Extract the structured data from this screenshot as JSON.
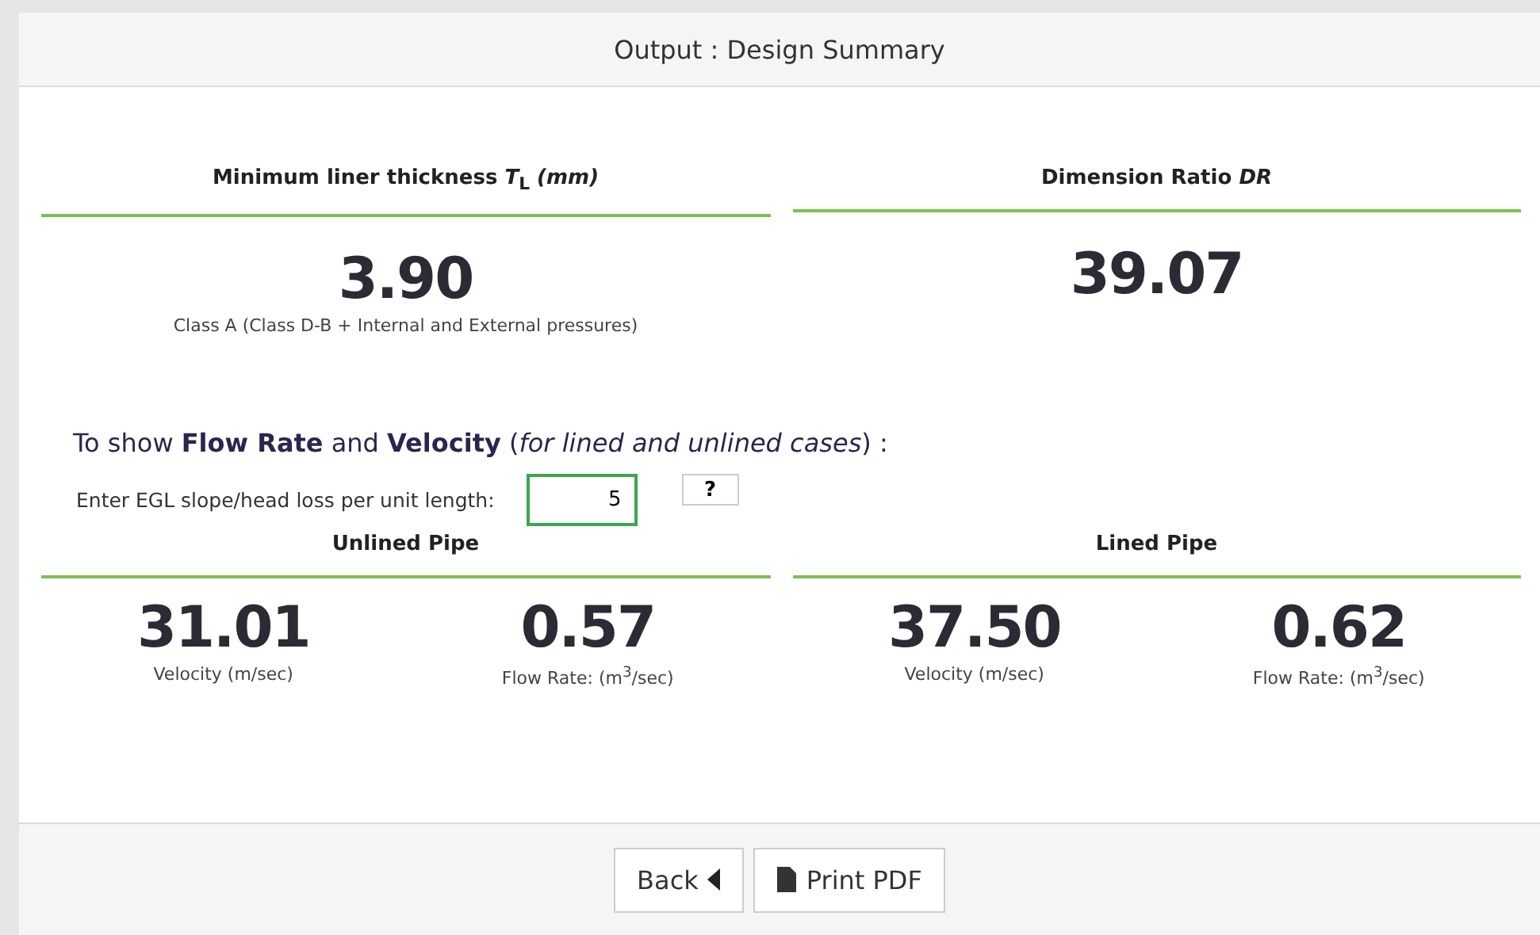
{
  "header": {
    "title": "Output : Design Summary"
  },
  "summary": [
    {
      "title": "Minimum liner thickness *T*$_{L}$ *(mm)*",
      "value": "3.90",
      "note": "Class A (Class D-B + Internal and External pressures)"
    },
    {
      "title": "Dimension Ratio *DR*",
      "value": "39.07"
    }
  ],
  "flow": {
    "intro": "To show **Flow Rate** and **Velocity** (*for lined and unlined cases*) :",
    "input_label": "Enter EGL slope/head loss per unit length:",
    "input_value": "5",
    "help": "?"
  },
  "pipes": [
    {
      "title": "Unlined Pipe",
      "metrics": [
        {
          "value": "31.01",
          "label": "Velocity (m/sec)"
        },
        {
          "value": "0.57",
          "label": "Flow Rate: (m$^{3}$/sec)"
        }
      ]
    },
    {
      "title": "Lined Pipe",
      "metrics": [
        {
          "value": "37.50",
          "label": "Velocity (m/sec)"
        },
        {
          "value": "0.62",
          "label": "Flow Rate: (m$^{3}$/sec)"
        }
      ]
    }
  ],
  "buttons": [
    {
      "label": "Back",
      "kind": "back"
    },
    {
      "label": "Print PDF",
      "kind": "print"
    }
  ]
}
